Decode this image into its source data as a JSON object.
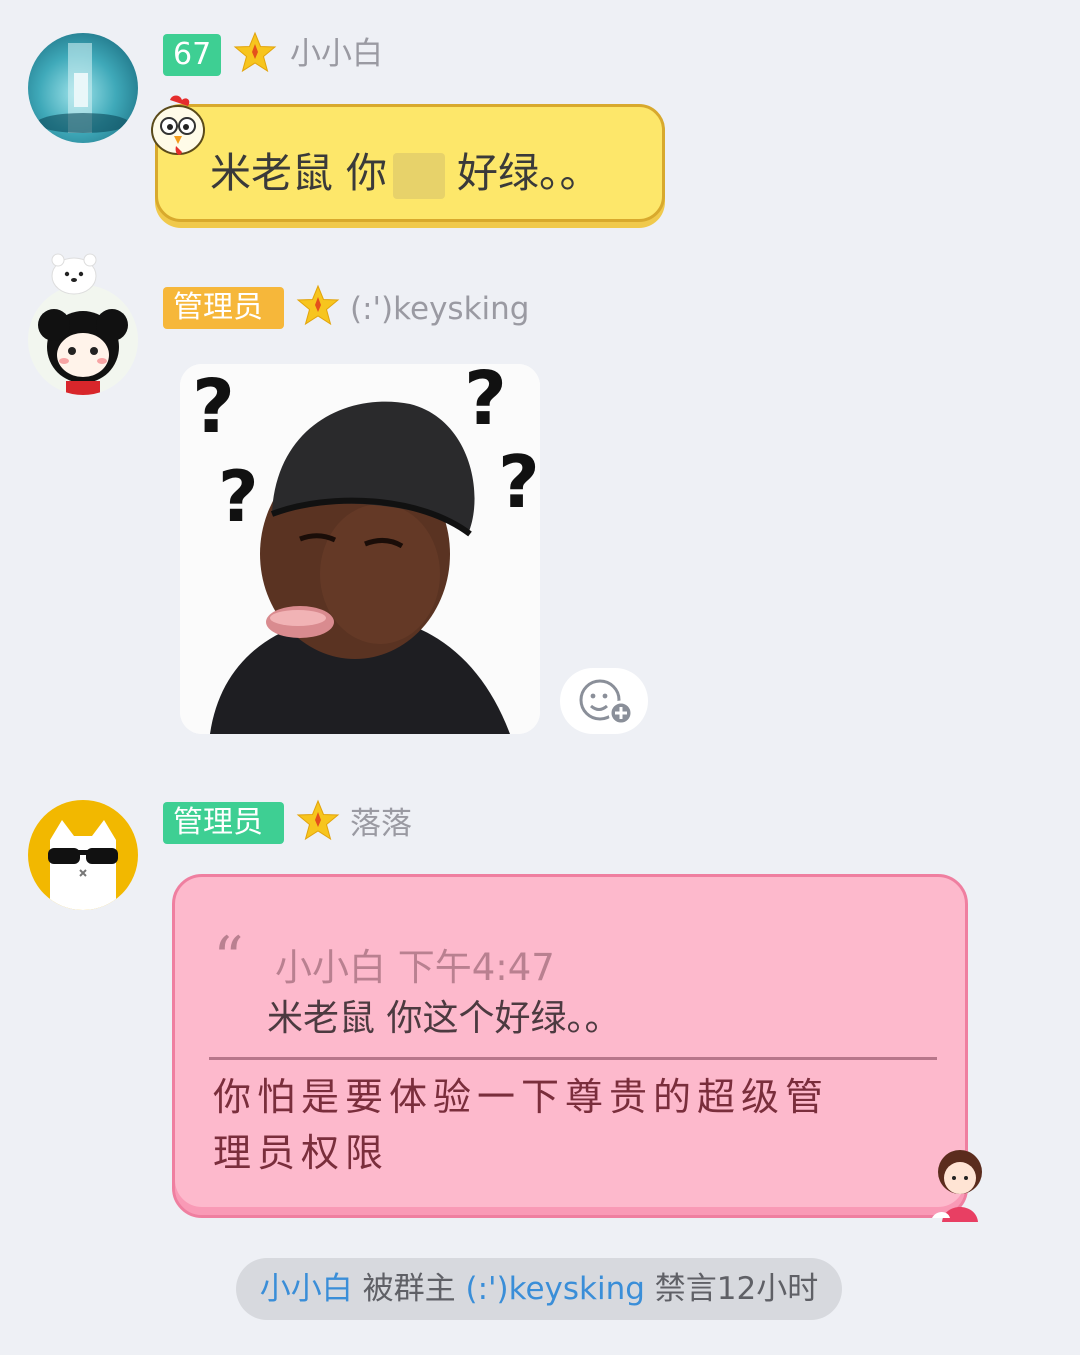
{
  "messages": [
    {
      "level_badge": "67",
      "sender": "小小白",
      "text_part1": "米老鼠 你",
      "text_part2": "好绿。。",
      "colors": {
        "badge": "#3ecf93",
        "bubble": "#fde76a"
      }
    },
    {
      "role_badge": "管理员",
      "sender": "(:')keysking",
      "sticker_marks": [
        "?",
        "?",
        "?",
        "?"
      ],
      "colors": {
        "badge": "#f6b73a"
      }
    },
    {
      "role_badge": "管理员",
      "sender": "落落",
      "quote": {
        "author": "小小白",
        "time": "下午4:47",
        "text": "米老鼠 你这个好绿。。"
      },
      "reply": "你怕是要体验一下尊贵的超级管理员权限",
      "colors": {
        "badge": "#3ecf93",
        "bubble": "#fdb9cc"
      }
    }
  ],
  "notice": {
    "target": "小小白",
    "action": " 被群主 ",
    "actor": "(:')keysking",
    "result": " 禁言12小时"
  },
  "icons": [
    "star-icon",
    "chicken-icon",
    "add-sticker-icon",
    "quote-icon"
  ]
}
